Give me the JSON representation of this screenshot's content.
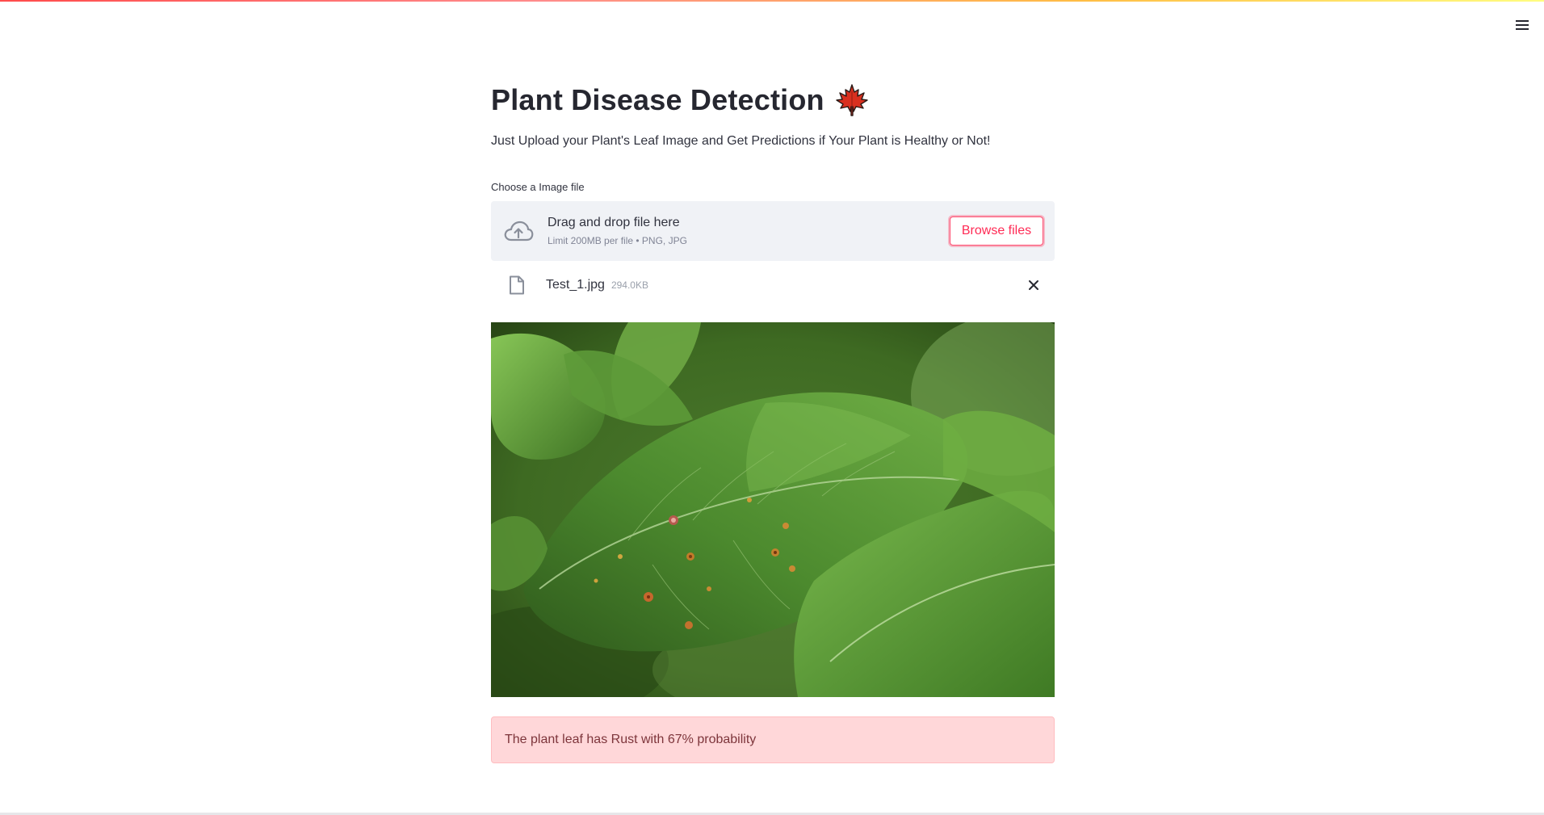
{
  "app": {
    "title": "Plant Disease Detection",
    "title_emoji": "maple-leaf-icon",
    "subtitle": "Just Upload your Plant's Leaf Image and Get Predictions if Your Plant is Healthy or Not!"
  },
  "uploader": {
    "label": "Choose a Image file",
    "drop_text": "Drag and drop file here",
    "limit_text": "Limit 200MB per file • PNG, JPG",
    "browse_label": "Browse files",
    "icon": "cloud-upload-icon"
  },
  "uploaded_file": {
    "name": "Test_1.jpg",
    "size": "294.0KB",
    "icon": "file-icon",
    "remove_icon": "close-icon"
  },
  "result": {
    "message": "The plant leaf has Rust with 67% probability"
  },
  "colors": {
    "accent": "#ff4b4b",
    "alert_bg": "#ffd7d9",
    "alert_text": "#7d353b",
    "dropzone_bg": "#f0f2f6"
  },
  "menu": {
    "icon": "hamburger-menu-icon"
  }
}
